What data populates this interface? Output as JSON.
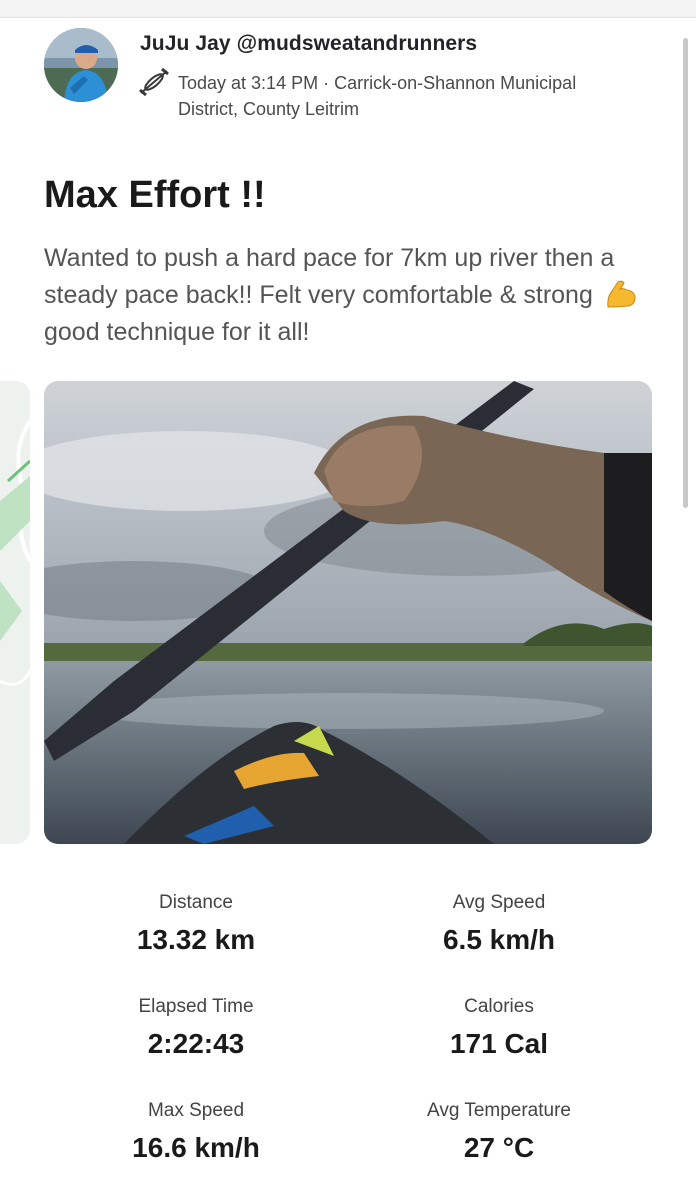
{
  "post": {
    "author": "JuJu Jay @mudsweatandrunners",
    "activity_icon": "kayak-icon",
    "meta_line1": "Today at 3:14 PM · Carrick-on-Shannon Municipal",
    "meta_line2": "District, County Leitrim",
    "title": "Max Effort !!",
    "description_part1": "Wanted to push a hard pace for 7km up river then a steady pace back!! Felt very comfortable & strong",
    "description_emoji": "flexed-biceps",
    "description_part2": "good technique for it all!"
  },
  "stats": [
    {
      "label": "Distance",
      "value": "13.32 km"
    },
    {
      "label": "Avg Speed",
      "value": "6.5 km/h"
    },
    {
      "label": "Elapsed Time",
      "value": "2:22:43"
    },
    {
      "label": "Calories",
      "value": "171 Cal"
    },
    {
      "label": "Max Speed",
      "value": "16.6 km/h"
    },
    {
      "label": "Avg Temperature",
      "value": "27 °C"
    }
  ],
  "colors": {
    "accent_green": "#5fbf6a",
    "text_dark": "#1a1a1a",
    "text_muted": "#555555"
  }
}
